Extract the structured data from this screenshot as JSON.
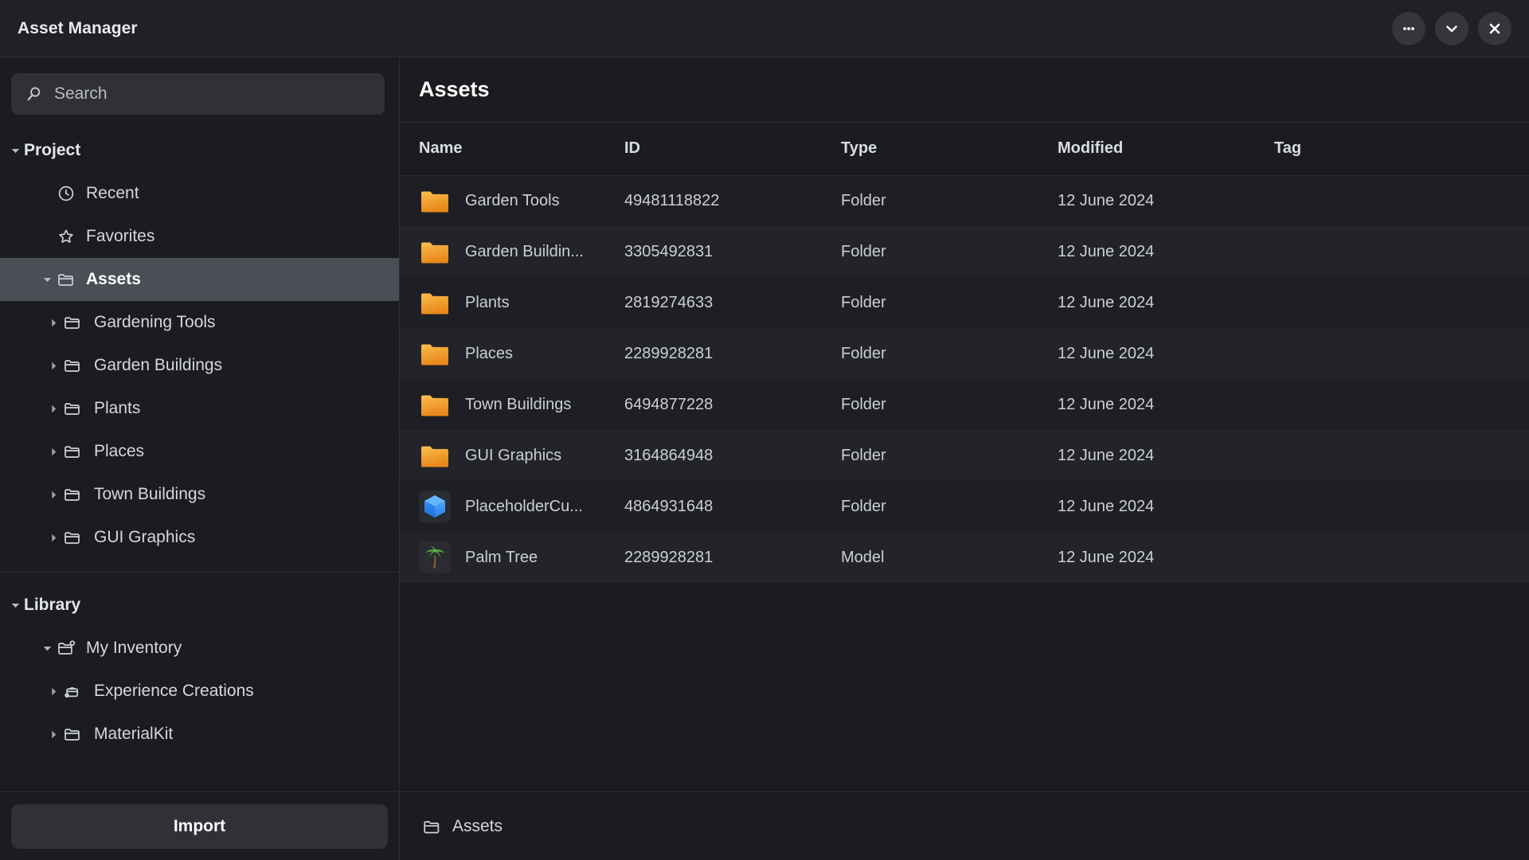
{
  "window": {
    "title": "Asset Manager",
    "controls": [
      {
        "name": "more-options-button",
        "icon": "ellipsis-icon"
      },
      {
        "name": "collapse-button",
        "icon": "chevron-down-icon"
      },
      {
        "name": "close-button",
        "icon": "close-icon"
      }
    ]
  },
  "search": {
    "placeholder": "Search",
    "value": "",
    "icon": "search-icon"
  },
  "sidebar": {
    "groups": [
      {
        "label": "Project",
        "expanded": true,
        "items": [
          {
            "label": "Recent",
            "icon": "clock-icon",
            "level": 1,
            "caret": "none",
            "selected": false
          },
          {
            "label": "Favorites",
            "icon": "star-icon",
            "level": 1,
            "caret": "none",
            "selected": false
          },
          {
            "label": "Assets",
            "icon": "folder-icon",
            "level": 1,
            "caret": "expanded",
            "selected": true
          },
          {
            "label": "Gardening Tools",
            "icon": "folder-icon",
            "level": 2,
            "caret": "collapsed",
            "selected": false
          },
          {
            "label": "Garden Buildings",
            "icon": "folder-icon",
            "level": 2,
            "caret": "collapsed",
            "selected": false
          },
          {
            "label": "Plants",
            "icon": "folder-icon",
            "level": 2,
            "caret": "collapsed",
            "selected": false
          },
          {
            "label": "Places",
            "icon": "folder-icon",
            "level": 2,
            "caret": "collapsed",
            "selected": false
          },
          {
            "label": "Town Buildings",
            "icon": "folder-icon",
            "level": 2,
            "caret": "collapsed",
            "selected": false
          },
          {
            "label": "GUI Graphics",
            "icon": "folder-icon",
            "level": 2,
            "caret": "collapsed",
            "selected": false
          }
        ]
      },
      {
        "label": "Library",
        "expanded": true,
        "items": [
          {
            "label": "My Inventory",
            "icon": "folder-badge-icon",
            "level": 1,
            "caret": "expanded",
            "selected": false
          },
          {
            "label": "Experience Creations",
            "icon": "package-icon",
            "level": 2,
            "caret": "collapsed",
            "selected": false
          },
          {
            "label": "MaterialKit",
            "icon": "folder-icon",
            "level": 2,
            "caret": "collapsed",
            "selected": false
          }
        ]
      }
    ],
    "import_label": "Import"
  },
  "main": {
    "title": "Assets",
    "columns": [
      "Name",
      "ID",
      "Type",
      "Modified",
      "Tag"
    ],
    "rows": [
      {
        "name": "Garden Tools",
        "id": "49481118822",
        "type": "Folder",
        "modified": "12 June 2024",
        "tag": "",
        "icon": "folder-orange-icon"
      },
      {
        "name": "Garden Buildin...",
        "id": "3305492831",
        "type": "Folder",
        "modified": "12 June 2024",
        "tag": "",
        "icon": "folder-orange-icon"
      },
      {
        "name": "Plants",
        "id": "2819274633",
        "type": "Folder",
        "modified": "12 June 2024",
        "tag": "",
        "icon": "folder-orange-icon"
      },
      {
        "name": "Places",
        "id": "2289928281",
        "type": "Folder",
        "modified": "12 June 2024",
        "tag": "",
        "icon": "folder-orange-icon"
      },
      {
        "name": "Town Buildings",
        "id": "6494877228",
        "type": "Folder",
        "modified": "12 June 2024",
        "tag": "",
        "icon": "folder-orange-icon"
      },
      {
        "name": "GUI Graphics",
        "id": "3164864948",
        "type": "Folder",
        "modified": "12 June 2024",
        "tag": "",
        "icon": "folder-orange-icon"
      },
      {
        "name": "PlaceholderCu...",
        "id": "4864931648",
        "type": "Folder",
        "modified": "12 June 2024",
        "tag": "",
        "icon": "blue-cube-icon"
      },
      {
        "name": "Palm Tree",
        "id": "2289928281",
        "type": "Model",
        "modified": "12 June 2024",
        "tag": "",
        "icon": "palm-tree-icon"
      }
    ]
  },
  "breadcrumb": {
    "icon": "folder-icon",
    "label": "Assets"
  },
  "colors": {
    "window_bg": "#1b1c20",
    "titlebar_bg": "#202126",
    "panel_border": "#2c2e33",
    "selection": "#4b4e55",
    "folder_orange": "#f2a23a",
    "cube_blue": "#2f8df7",
    "text_primary": "#e8eaed",
    "text_secondary": "#cbcfd5"
  }
}
